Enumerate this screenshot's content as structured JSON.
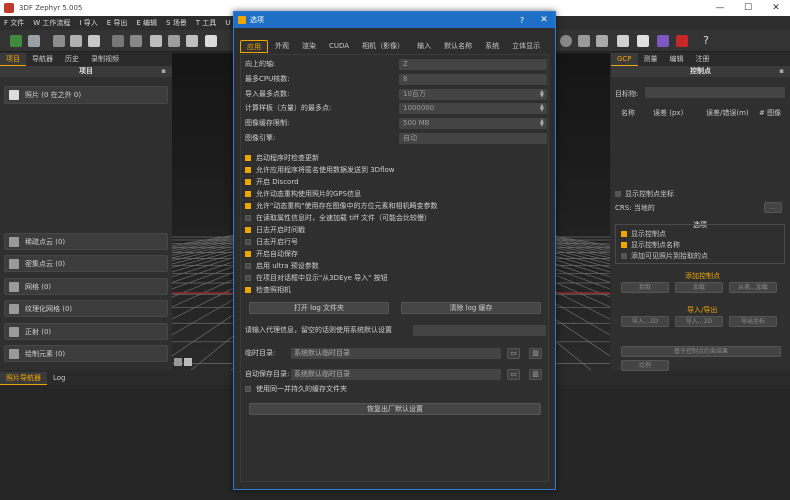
{
  "window": {
    "title": "3DF Zephyr 5.005",
    "min": "—",
    "max": "☐",
    "close": "✕"
  },
  "menus": [
    "F 文件",
    "W 工作流程",
    "I 导入",
    "E 导出",
    "E 编辑",
    "S 场景",
    "T 工具",
    "U 实用程序"
  ],
  "left": {
    "tabs": [
      "项目",
      "导航器",
      "历史",
      "录制视频"
    ],
    "header": "项目",
    "photos": "照片 (0 在之外 0)",
    "groups": [
      "稀疏点云 (0)",
      "密集点云 (0)",
      "网格 (0)",
      "纹理化网格 (0)",
      "正射 (0)",
      "绘制元素 (0)"
    ]
  },
  "right": {
    "tabs": [
      "GCP",
      "测量",
      "编辑",
      "注册"
    ],
    "header": "控制点",
    "target_label": "目标物:",
    "cols": [
      "名称",
      "误差 (px)",
      "误差/错误(m)",
      "# 图像"
    ],
    "show_axis": "显示控制点坐标",
    "crs_label": "CRS: 当地的",
    "options_title": "选项",
    "opt1": "显示控制点",
    "opt2": "显示控制点名称",
    "opt3": "添加可见照片到拾取的点",
    "add_title": "添加控制点",
    "add_btns": [
      "拾取",
      "加载",
      "从表...加载"
    ],
    "io_title": "导入/导出",
    "io_btns": [
      "导入...3D",
      "导入...2D",
      "导出坐标"
    ],
    "bottom_btn": "基于控制点约束结果",
    "scale_btn": "比例"
  },
  "bottom": {
    "tabs": [
      "照片导航器",
      "Log"
    ]
  },
  "dialog": {
    "title": "选项",
    "help": "?",
    "close": "✕",
    "tabs": [
      "应用",
      "外观",
      "渲染",
      "CUDA",
      "相机（影像）",
      "输入",
      "默认名称",
      "系统",
      "立体显示"
    ],
    "fields": [
      {
        "label": "向上的轴:",
        "value": "Z"
      },
      {
        "label": "最多CPU核数:",
        "value": "8"
      },
      {
        "label": "导入最多点数:",
        "value": "10百万"
      },
      {
        "label": "计算样板（方量）的最多点:",
        "value": "1000000"
      },
      {
        "label": "图像缓存限制:",
        "value": "500 MB"
      },
      {
        "label": "图像引擎:",
        "value": "自动"
      }
    ],
    "checks": [
      {
        "label": "启动程序时检查更新",
        "on": true
      },
      {
        "label": "允许应用程序将匿名使用数据发送到 3Dflow",
        "on": true
      },
      {
        "label": "开启 Discord",
        "on": true
      },
      {
        "label": "允许动态重构使用照片的GPS信息",
        "on": true
      },
      {
        "label": "允许\"动态重构\"使用存在图像中的方位元素和相机畸变参数",
        "on": true
      },
      {
        "label": "在读取属性信息时，全速加载 tiff 文件（可能会比较慢）",
        "on": false
      },
      {
        "label": "日志开启时间戳",
        "on": true
      },
      {
        "label": "日志开启行号",
        "on": false
      },
      {
        "label": "开启自动保存",
        "on": true
      },
      {
        "label": "启用 ultra 预设参数",
        "on": false
      },
      {
        "label": "在项目对话框中显示\"从3DEye 导入\" 按钮",
        "on": false
      },
      {
        "label": "检查照相机",
        "on": true
      }
    ],
    "open_log": "打开 log 文件夹",
    "clear_log": "清除 log 缓存",
    "proxy_label": "请输入代理信息，留空的话则使用系统默认设置",
    "temp_label": "临时目录:",
    "temp_value": "系统默认临时目录",
    "autosave_label": "自动保存目录:",
    "autosave_value": "系统默认临时目录",
    "same_cache": "使用同一并持久的缓存文件夹",
    "reset": "恢复出厂默认设置"
  }
}
